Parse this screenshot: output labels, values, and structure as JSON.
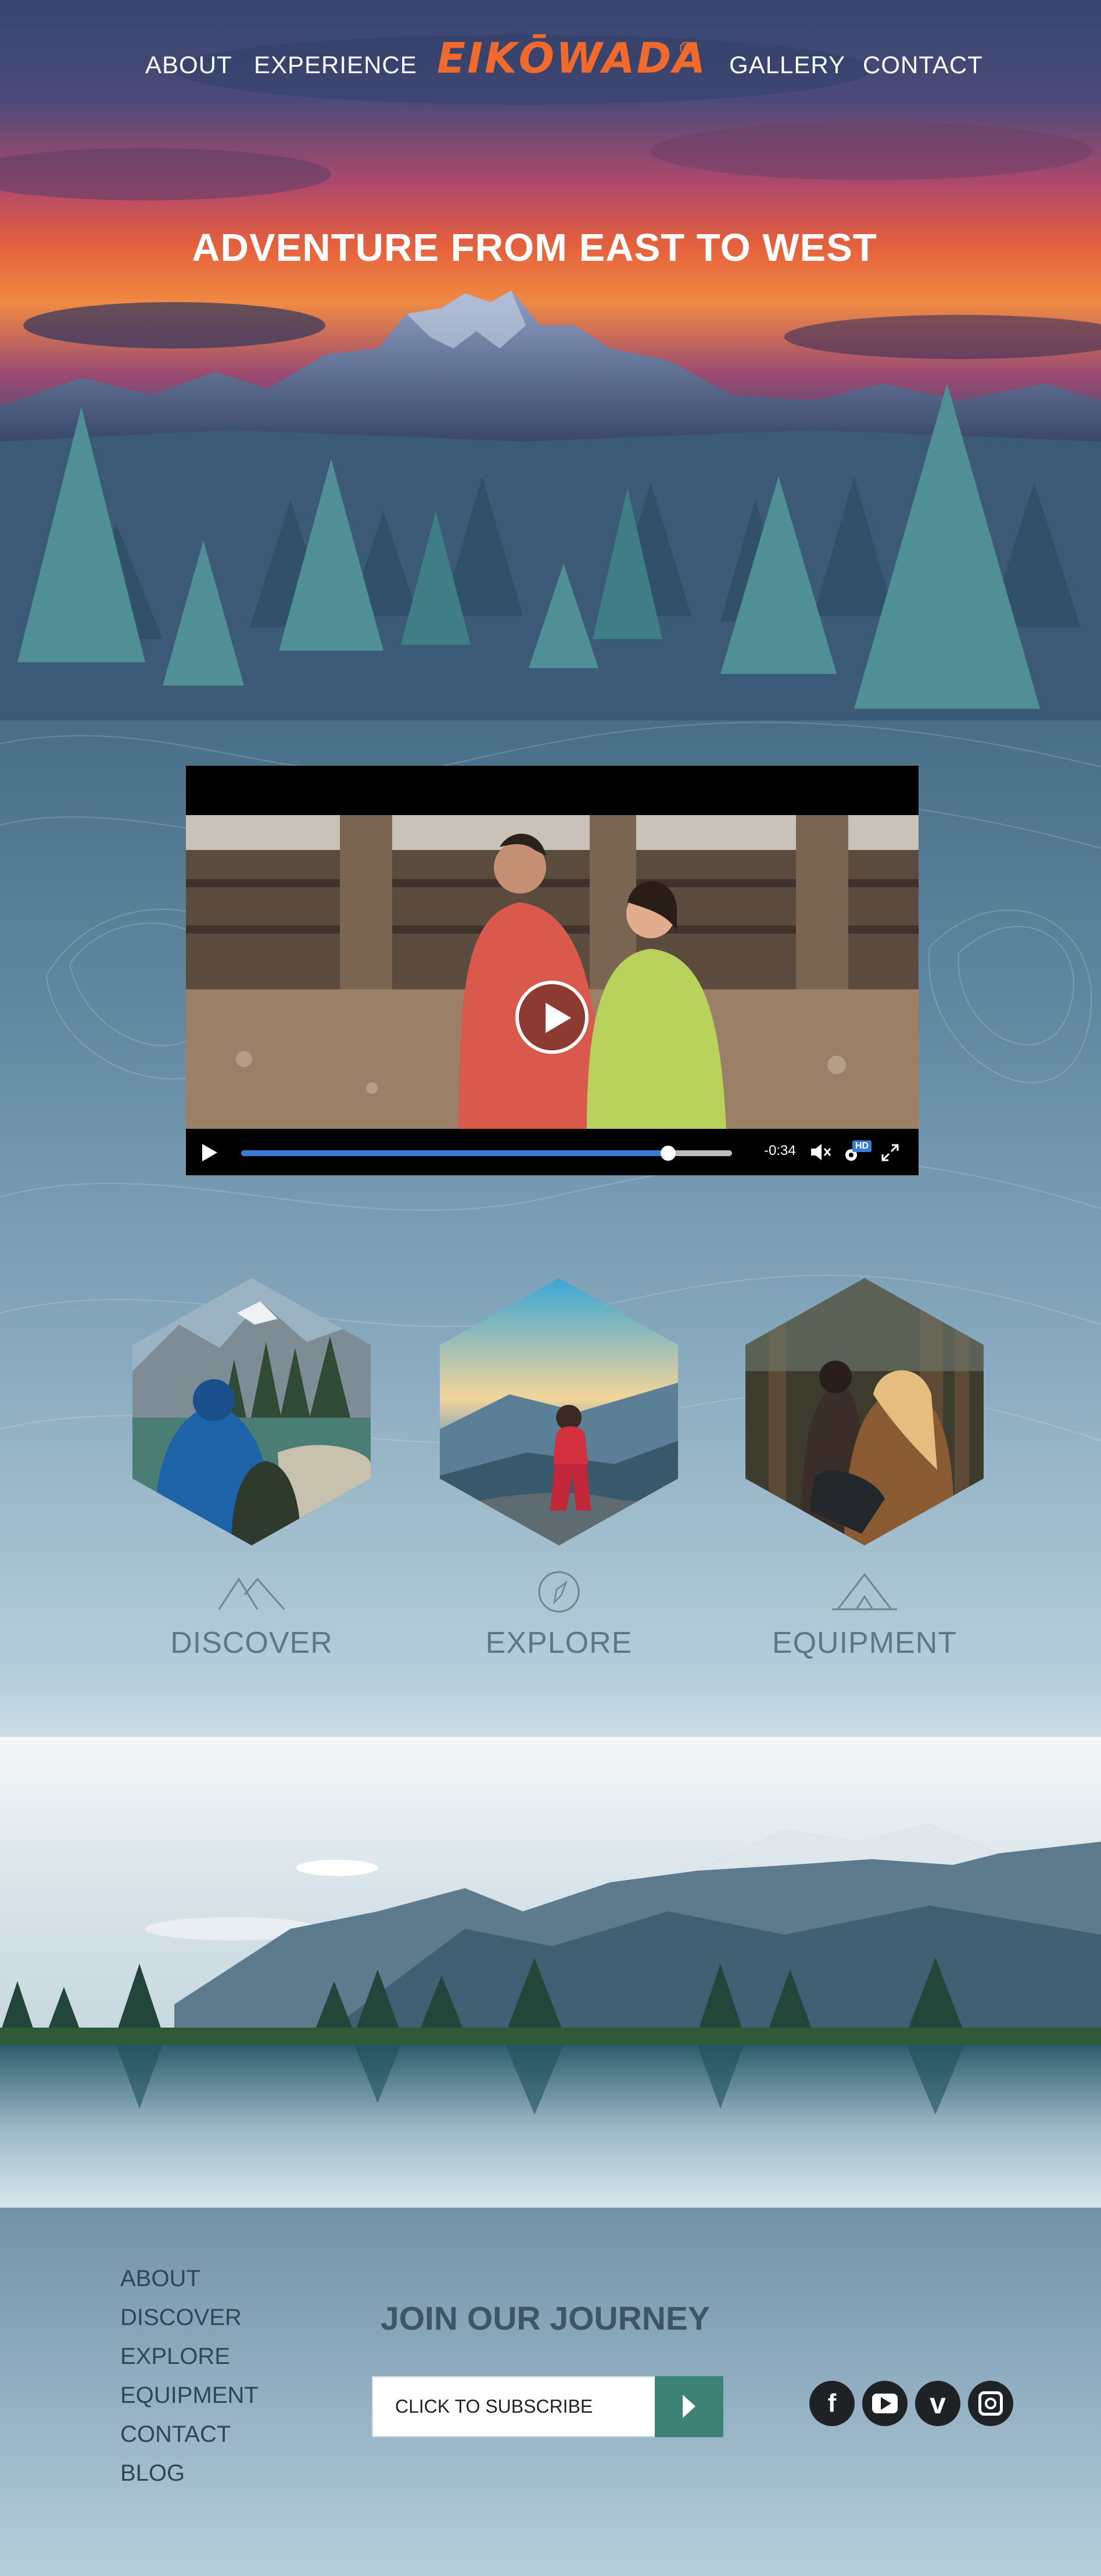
{
  "nav": {
    "left": [
      "ABOUT",
      "EXPERIENCE"
    ],
    "right": [
      "GALLERY",
      "CONTACT"
    ],
    "logo_text": "EIKŌWADA",
    "logo_mark": "®"
  },
  "hero": {
    "title": "ADVENTURE FROM EAST TO WEST"
  },
  "video": {
    "time_remaining": "-0:34",
    "hd_badge": "HD",
    "progress_fraction": 0.87
  },
  "features": [
    {
      "label": "DISCOVER",
      "icon": "mountains-icon"
    },
    {
      "label": "EXPLORE",
      "icon": "compass-icon"
    },
    {
      "label": "EQUIPMENT",
      "icon": "tent-icon"
    }
  ],
  "footer": {
    "links": [
      "ABOUT",
      "DISCOVER",
      "EXPLORE",
      "EQUIPMENT",
      "CONTACT",
      "BLOG"
    ],
    "join_title": "JOIN OUR JOURNEY",
    "subscribe_placeholder": "CLICK TO SUBSCRIBE",
    "social": [
      {
        "name": "facebook-icon",
        "glyph": "f"
      },
      {
        "name": "youtube-icon",
        "glyph": "▶"
      },
      {
        "name": "vimeo-icon",
        "glyph": "v"
      },
      {
        "name": "instagram-icon",
        "glyph": "◎"
      }
    ]
  },
  "colors": {
    "brand_orange": "#ef6a2c",
    "subscribe_green": "#3d8276",
    "video_progress_blue": "#3a7bd5"
  }
}
